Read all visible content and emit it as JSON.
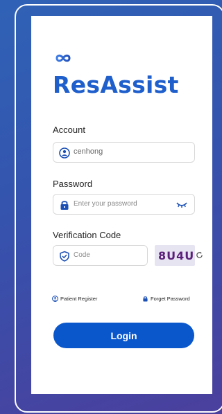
{
  "app": {
    "title": "ResAssist",
    "brand_color": "#1f5fcc"
  },
  "account": {
    "label": "Account",
    "value": "cenhong",
    "icon": "user-icon"
  },
  "password": {
    "label": "Password",
    "placeholder": "Enter your password",
    "icon": "lock-icon",
    "toggle_icon": "eye-closed-icon"
  },
  "verification": {
    "label": "Verification Code",
    "placeholder": "Code",
    "icon": "shield-check-icon",
    "captcha": "8U4U",
    "refresh_icon": "refresh-icon"
  },
  "links": {
    "register": "Patient Register",
    "forget": "Forget Password"
  },
  "actions": {
    "login": "Login",
    "button_color": "#0a57cc"
  }
}
